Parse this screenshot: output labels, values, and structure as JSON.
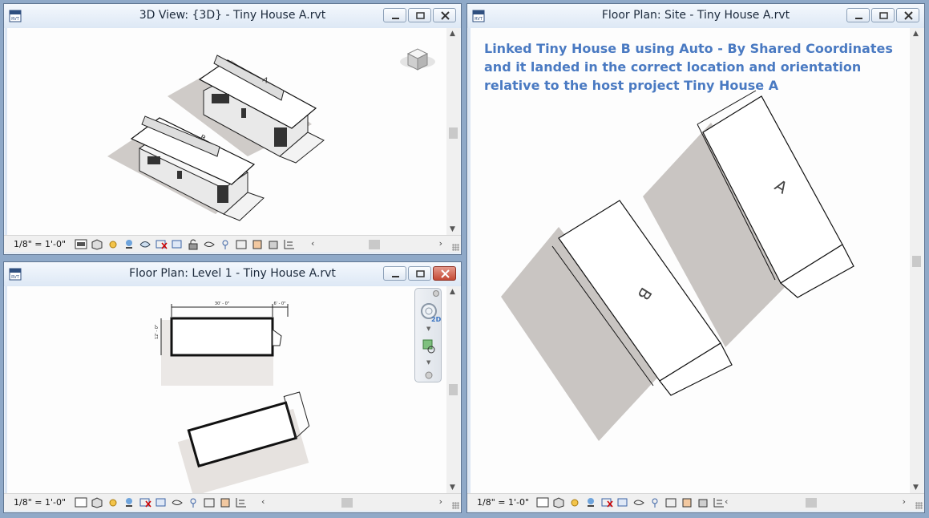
{
  "app_icon": "rvt-icon",
  "windows": {
    "view3d": {
      "title": "3D View: {3D} - Tiny House A.rvt",
      "scale": "1/8\" = 1'-0\""
    },
    "level1": {
      "title": "Floor Plan: Level 1 - Tiny House A.rvt",
      "scale": "1/8\" = 1'-0\"",
      "dim_top": "30' - 0\"",
      "dim_side": "6' - 0\"",
      "dim_left": "12' - 0\""
    },
    "site": {
      "title": "Floor Plan: Site - Tiny House A.rvt",
      "scale": "1/8\" = 1'-0\"",
      "note": [
        "Linked Tiny House B using Auto - By Shared Coordinates",
        "and it landed in the correct location and orientation",
        "relative to the host project Tiny House A"
      ],
      "label_a": "A",
      "label_b": "B"
    }
  },
  "icon_rvt": "RVT",
  "navbar_label": "2D",
  "colors": {
    "note": "#4a7ac2",
    "shadow": "#c9c5c2",
    "frame": "#5f7591"
  }
}
